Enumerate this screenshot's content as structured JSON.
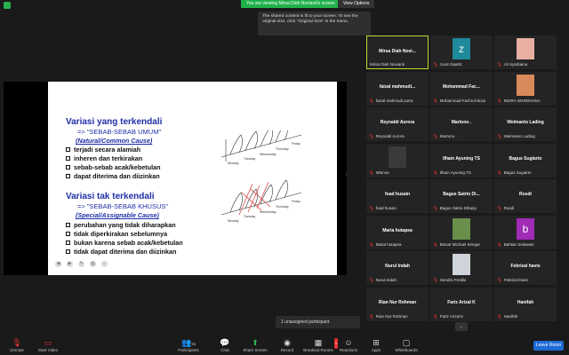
{
  "topbar": {
    "viewing_text": "You are viewing Mirsa Diah Novianti's screen",
    "view_options_label": "View Options"
  },
  "tooltip": "The shared content is fit to your screen. To see the original size, click \"Original Size\" in the menu.",
  "slide": {
    "title1": "Variasi yang terkendali",
    "sub1": "=> \"SEBAB-SEBAB UMUM\"",
    "italic1": "(Natural/Common Cause)",
    "bullets1": [
      "terjadi secara alamiah",
      "inheren dan terkirakan",
      "sebab-sebab acak/kebetulan",
      "dapat diterima dan diizinkan"
    ],
    "title2": "Variasi tak terkendali",
    "sub2": "=> \"SEBAB-SEBAB KHUSUS\"",
    "italic2": "(Special/Assignable Cause)",
    "bullets2": [
      "perubahan yang tidak diharapkan",
      "tidak diperkirakan sebelumnya",
      "bukan karena sebab acak/kebetulan",
      "tidak dapat diterima dan diizinkan"
    ],
    "days1": [
      "Monday",
      "Tuesday",
      "Wednesday",
      "Thursday",
      "Friday"
    ],
    "days2": [
      "Monday",
      "Tuesday",
      "Wednesday",
      "Thursday",
      "Friday"
    ],
    "controls": [
      "◀",
      "▶",
      "✎",
      "▤",
      "⋯"
    ]
  },
  "gallery": {
    "tiles": [
      {
        "name": "Mirsa Diah Novi...",
        "label": "Mirsa Diah Novianti",
        "muted": false,
        "avatar": "none",
        "active": true
      },
      {
        "name": "",
        "label": "zoom baa04",
        "muted": true,
        "avatar": "z",
        "avatar_color": "#1f8a9c"
      },
      {
        "name": "",
        "label": "Ali Syarbaina",
        "muted": true,
        "avatar": "photo",
        "avatar_color": "#e7b0a0"
      },
      {
        "name": "faizal mahmudi...",
        "label": "faizal mahmudi putra",
        "muted": true
      },
      {
        "name": "Mohammad Fac...",
        "label": "Mohammad Fachrul Nizar",
        "muted": true
      },
      {
        "name": "",
        "label": "INDRA WARDHANA",
        "muted": true,
        "avatar": "photo",
        "avatar_color": "#d88a5a"
      },
      {
        "name": "Reynaldi Aurora",
        "label": "Reynaldi Aurora",
        "muted": true
      },
      {
        "name": "Martono .",
        "label": "Martono .",
        "muted": true
      },
      {
        "name": "Welmanto Lading",
        "label": "Welmanto Lading",
        "muted": true
      },
      {
        "name": "",
        "label": "Wisnoe",
        "muted": true,
        "avatar": "photo",
        "avatar_color": "#3a3a3a"
      },
      {
        "name": "Ilham Ayuning TS",
        "label": "Ilham Ayuning TS",
        "muted": true
      },
      {
        "name": "Bagus Sugiarto",
        "label": "Bagus Sugiarto",
        "muted": true
      },
      {
        "name": "fuad husain",
        "label": "fuad husain",
        "muted": true
      },
      {
        "name": "Bagus Satrio Di...",
        "label": "Bagus Satrio Diharjo",
        "muted": true
      },
      {
        "name": "Rusdi",
        "label": "Rusdi",
        "muted": true
      },
      {
        "name": "Maria hutapea",
        "label": "Maria hutapea",
        "muted": true
      },
      {
        "name": "",
        "label": "Binsar Michael Siregar",
        "muted": true,
        "avatar": "photo",
        "avatar_color": "#6a8f4a"
      },
      {
        "name": "",
        "label": "Bahtiar Setiawan",
        "muted": true,
        "avatar": "b",
        "avatar_color": "#a02bb5"
      },
      {
        "name": "Nurul Indah",
        "label": "Nurul Indah",
        "muted": true
      },
      {
        "name": "",
        "label": "Hendra Ferdila",
        "muted": true,
        "avatar": "photo",
        "avatar_color": "#cfd3da"
      },
      {
        "name": "Febrizal havis",
        "label": "Febrizal havis",
        "muted": true
      },
      {
        "name": "Rian Nur Rohman",
        "label": "Rian Nur Rohman",
        "muted": true
      },
      {
        "name": "Fariz Arizal K",
        "label": "Fariz Arizal K",
        "muted": true
      },
      {
        "name": "Hanifah",
        "label": "Hanifah",
        "muted": true
      }
    ]
  },
  "unassigned_text": "1 unassigned participant",
  "toolbar": {
    "unmute": "Unmute",
    "start_video": "Start Video",
    "participants": "Participants",
    "participants_count": "55",
    "chat": "Chat",
    "share_screen": "Share Screen",
    "record": "Record",
    "breakout": "Breakout Rooms",
    "breakout_badge": "1",
    "reactions": "Reactions",
    "apps": "Apps",
    "whiteboards": "Whiteboards",
    "leave": "Leave Room"
  }
}
